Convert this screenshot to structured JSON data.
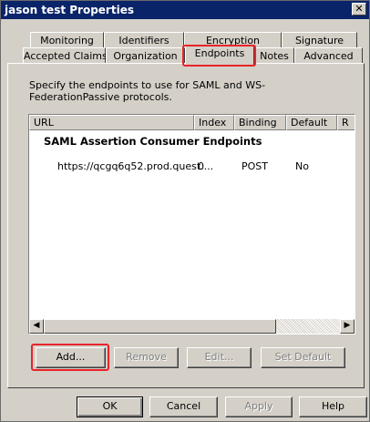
{
  "window": {
    "title": "jason test Properties",
    "close_label": "✕"
  },
  "tabs": {
    "back_row": [
      "Monitoring",
      "Identifiers",
      "Encryption",
      "Signature"
    ],
    "front_row": [
      "Accepted Claims",
      "Organization",
      "Endpoints",
      "Notes",
      "Advanced"
    ],
    "active": "Endpoints"
  },
  "description": "Specify the endpoints to use for SAML and WS-FederationPassive protocols.",
  "list": {
    "columns": [
      "URL",
      "Index",
      "Binding",
      "Default",
      "R"
    ],
    "group_header": "SAML Assertion Consumer Endpoints",
    "rows": [
      {
        "url": "https://qcgq6q52.prod.quest....",
        "index": "0",
        "binding": "POST",
        "default": "No"
      }
    ]
  },
  "scrollbar": {
    "left_arrow": "◀",
    "right_arrow": "▶"
  },
  "actions": {
    "add": "Add...",
    "remove": "Remove",
    "edit": "Edit...",
    "set_default": "Set Default"
  },
  "footer": {
    "ok": "OK",
    "cancel": "Cancel",
    "apply": "Apply",
    "help": "Help"
  },
  "colors": {
    "titlebar": "#0a246a",
    "dialog_face": "#d4d0c8",
    "annotation_red": "#e8232a"
  }
}
